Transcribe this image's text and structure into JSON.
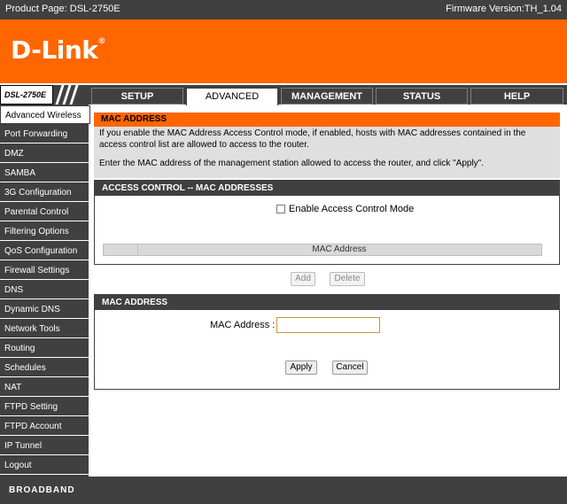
{
  "topbar": {
    "product": "Product Page: DSL-2750E",
    "firmware": "Firmware Version:TH_1.04"
  },
  "logo": {
    "text": "D-Link",
    "mark": "®"
  },
  "model": "DSL-2750E",
  "tabs": [
    {
      "label": "SETUP",
      "active": false
    },
    {
      "label": "ADVANCED",
      "active": true
    },
    {
      "label": "MANAGEMENT",
      "active": false
    },
    {
      "label": "STATUS",
      "active": false
    },
    {
      "label": "HELP",
      "active": false
    }
  ],
  "sidebar": [
    {
      "label": "Advanced Wireless",
      "active": true
    },
    {
      "label": "Port Forwarding"
    },
    {
      "label": "DMZ"
    },
    {
      "label": "SAMBA"
    },
    {
      "label": "3G Configuration"
    },
    {
      "label": "Parental Control"
    },
    {
      "label": "Filtering Options"
    },
    {
      "label": "QoS Configuration"
    },
    {
      "label": "Firewall Settings"
    },
    {
      "label": "DNS"
    },
    {
      "label": "Dynamic DNS"
    },
    {
      "label": "Network Tools"
    },
    {
      "label": "Routing"
    },
    {
      "label": "Schedules"
    },
    {
      "label": "NAT"
    },
    {
      "label": "FTPD Setting"
    },
    {
      "label": "FTPD Account"
    },
    {
      "label": "IP Tunnel"
    },
    {
      "label": "Logout"
    }
  ],
  "intro": {
    "title": "MAC ADDRESS",
    "text1": "If you enable the MAC Address Access Control mode, if enabled, hosts with MAC addresses contained in the access control list are allowed to access to the router.",
    "text2": "Enter the MAC address of the management station allowed to access the router, and click \"Apply\"."
  },
  "access_control": {
    "title": "ACCESS CONTROL -- MAC ADDRESSES",
    "checkbox_label": "Enable Access Control Mode",
    "checkbox_checked": false,
    "table_header": "MAC Address",
    "add_label": "Add",
    "delete_label": "Delete"
  },
  "mac_form": {
    "title": "MAC ADDRESS",
    "field_label": "MAC Address :",
    "field_value": "",
    "apply_label": "Apply",
    "cancel_label": "Cancel"
  },
  "footer": {
    "text": "BROADBAND"
  },
  "colors": {
    "orange": "#ff6600",
    "dark": "#404040",
    "grey": "#dfdfdf"
  }
}
